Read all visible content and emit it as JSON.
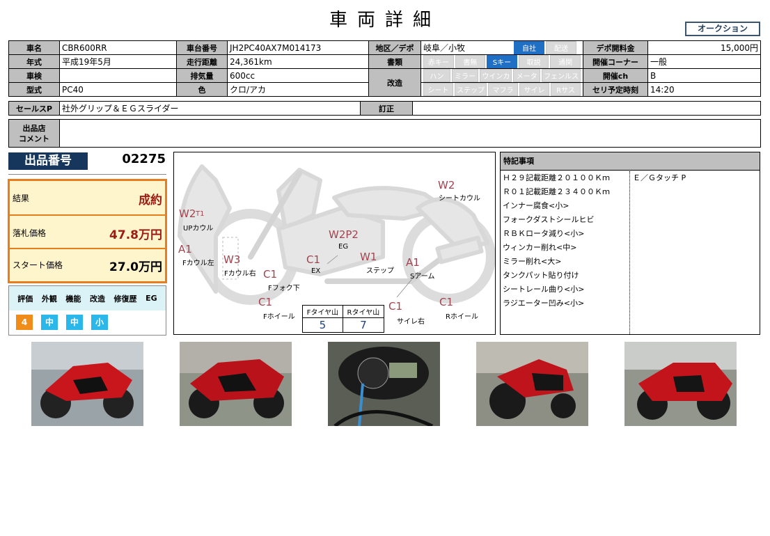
{
  "header": {
    "title": "車両詳細",
    "auction_badge": "オークション"
  },
  "vehicle": {
    "name_label": "車名",
    "name": "CBR600RR",
    "chassis_label": "車台番号",
    "chassis": "JH2PC40AX7M014173",
    "region_label": "地区／デポ",
    "region": "岐阜／小牧",
    "region_chips": [
      {
        "label": "自社",
        "on": true
      },
      {
        "label": "配送",
        "on": false
      }
    ],
    "depo_fee_label": "デポ開料金",
    "depo_fee": "15,000円",
    "year_label": "年式",
    "year": "平成19年5月",
    "mileage_label": "走行距離",
    "mileage": "24,361km",
    "docs_label": "書類",
    "docs_chips": [
      {
        "label": "赤キー",
        "on": false
      },
      {
        "label": "書無",
        "on": false
      },
      {
        "label": "Sキー",
        "on": true
      },
      {
        "label": "取説",
        "on": false
      },
      {
        "label": "通関",
        "on": false
      }
    ],
    "corner_label": "開催コーナー",
    "corner": "一般",
    "inspection_label": "車検",
    "inspection": "",
    "displacement_label": "排気量",
    "displacement": "600cc",
    "mod_label": "改造",
    "mod_chips_1": [
      {
        "label": "ハン",
        "on": false
      },
      {
        "label": "ミラー",
        "on": false
      },
      {
        "label": "ウインカ",
        "on": false
      },
      {
        "label": "メータ",
        "on": false
      },
      {
        "label": "フェンルス",
        "on": false
      }
    ],
    "mod_chips_2": [
      {
        "label": "シート",
        "on": false
      },
      {
        "label": "ステップ",
        "on": false
      },
      {
        "label": "マフラ",
        "on": false
      },
      {
        "label": "サイレ",
        "on": false
      },
      {
        "label": "Rサス",
        "on": false
      }
    ],
    "ch_label": "開催ch",
    "ch": "B",
    "model_label": "型式",
    "model": "PC40",
    "color_label": "色",
    "color": "クロ/アカ",
    "time_label": "セリ予定時刻",
    "time": "14:20",
    "salespoint_label": "セールスP",
    "salespoint": "社外グリップ＆ＥＧスライダー",
    "correction_label": "訂正",
    "correction": "",
    "comment_label_1": "出品店",
    "comment_label_2": "コメント",
    "comment": ""
  },
  "lot": {
    "label": "出品番号",
    "number": "02275"
  },
  "result": {
    "result_label": "結果",
    "result": "成約",
    "bid_label": "落札価格",
    "bid": "47.8万円",
    "start_label": "スタート価格",
    "start": "27.0万円"
  },
  "evaluation": {
    "headers": [
      "評価",
      "外観",
      "機能",
      "改造",
      "修復歴",
      "EG"
    ],
    "values": [
      {
        "v": "4",
        "c": "orange"
      },
      {
        "v": "中",
        "c": "cyan"
      },
      {
        "v": "中",
        "c": "cyan"
      },
      {
        "v": "小",
        "c": "cyan"
      }
    ]
  },
  "diagram": {
    "marks": [
      {
        "code": "W2",
        "label": "シートカウル"
      },
      {
        "code": "W2",
        "sub": "T1",
        "label": "UPカウル"
      },
      {
        "code": "W2P2",
        "label": "EG"
      },
      {
        "code": "A1",
        "label": "Fカウル左"
      },
      {
        "code": "W3",
        "label": "Fカウル右"
      },
      {
        "code": "C1",
        "label": "EX"
      },
      {
        "code": "W1",
        "label": "ステップ"
      },
      {
        "code": "A1",
        "label": "Sアーム"
      },
      {
        "code": "C1",
        "label": "Fフォク下"
      },
      {
        "code": "C1",
        "label": "Fホイール"
      },
      {
        "code": "C1",
        "label": "サイレ右"
      },
      {
        "code": "C1",
        "label": "Rホイール"
      }
    ],
    "tire": {
      "f_label": "Fタイヤ山",
      "r_label": "Rタイヤ山",
      "f": "5",
      "r": "7"
    }
  },
  "notes": {
    "title": "特記事項",
    "col1": [
      "Ｈ２９記載距離２０１００Ｋｍ",
      "Ｒ０１記載距離２３４００Ｋｍ",
      "インナー腐食<小>",
      "フォークダストシールヒビ",
      "ＲＢＫロータ減り<小>",
      "ウィンカー削れ<中>",
      "ミラー削れ<大>",
      "タンクパット貼り付け",
      "シートレール曲り<小>",
      "ラジエーター凹み<小>"
    ],
    "col2": [
      "Ｅ／Ｇタッチ P"
    ]
  },
  "colors": {
    "accent_navy": "#16365c",
    "result_orange": "#e87d1e",
    "chip_blue": "#1f6fc5",
    "mark_red": "#a1444f"
  }
}
